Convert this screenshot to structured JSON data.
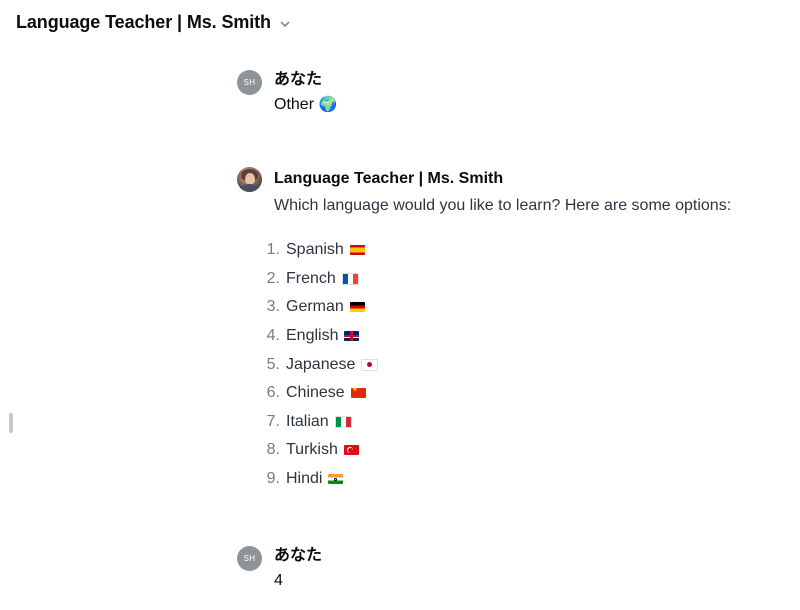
{
  "header": {
    "title": "Language Teacher | Ms. Smith",
    "dropdown_icon": "chevron-down-icon"
  },
  "messages": [
    {
      "role": "user",
      "avatar_initials": "SH",
      "author": "あなた",
      "text": "Other",
      "emoji": "🌍"
    },
    {
      "role": "assistant",
      "avatar_icon": "teacher-avatar",
      "author": "Language Teacher | Ms. Smith",
      "text": "Which language would you like to learn? Here are some options:",
      "options": [
        {
          "number": "1.",
          "label": "Spanish",
          "flag": "spain-flag-icon"
        },
        {
          "number": "2.",
          "label": "French",
          "flag": "france-flag-icon"
        },
        {
          "number": "3.",
          "label": "German",
          "flag": "germany-flag-icon"
        },
        {
          "number": "4.",
          "label": "English",
          "flag": "uk-flag-icon"
        },
        {
          "number": "5.",
          "label": "Japanese",
          "flag": "japan-flag-icon"
        },
        {
          "number": "6.",
          "label": "Chinese",
          "flag": "china-flag-icon"
        },
        {
          "number": "7.",
          "label": "Italian",
          "flag": "italy-flag-icon"
        },
        {
          "number": "8.",
          "label": "Turkish",
          "flag": "turkey-flag-icon"
        },
        {
          "number": "9.",
          "label": "Hindi",
          "flag": "india-flag-icon"
        }
      ]
    },
    {
      "role": "user",
      "avatar_initials": "SH",
      "author": "あなた",
      "text": "4"
    }
  ],
  "colors": {
    "user_avatar": "#8c9498",
    "text_primary": "#0d0d0d",
    "text_secondary": "#2e3440",
    "number_gray": "#7a7a7a"
  }
}
